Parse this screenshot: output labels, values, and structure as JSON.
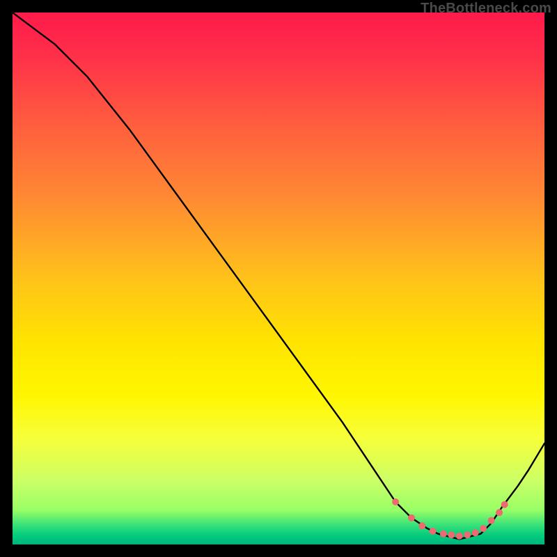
{
  "watermark": "TheBottleneck.com",
  "chart_data": {
    "type": "line",
    "title": "",
    "xlabel": "",
    "ylabel": "",
    "xlim": [
      0,
      100
    ],
    "ylim": [
      0,
      100
    ],
    "grid": false,
    "legend": false,
    "gradient_stops": [
      {
        "t": 0.0,
        "color": "#ff1a4b"
      },
      {
        "t": 0.08,
        "color": "#ff2f49"
      },
      {
        "t": 0.2,
        "color": "#ff5a3f"
      },
      {
        "t": 0.35,
        "color": "#ff8a33"
      },
      {
        "t": 0.5,
        "color": "#ffc21a"
      },
      {
        "t": 0.62,
        "color": "#ffe400"
      },
      {
        "t": 0.72,
        "color": "#fff600"
      },
      {
        "t": 0.8,
        "color": "#f7ff3a"
      },
      {
        "t": 0.88,
        "color": "#ccff66"
      },
      {
        "t": 0.935,
        "color": "#99ff66"
      },
      {
        "t": 0.965,
        "color": "#33e07a"
      },
      {
        "t": 0.985,
        "color": "#00c97e"
      },
      {
        "t": 1.0,
        "color": "#00b37d"
      }
    ],
    "series": [
      {
        "name": "bottleneck-curve",
        "x": [
          0,
          8,
          14,
          22,
          30,
          38,
          46,
          54,
          62,
          68,
          72,
          75,
          78,
          80,
          82,
          84,
          86,
          88,
          90,
          92,
          95,
          97,
          100
        ],
        "y": [
          100,
          94,
          88,
          78,
          67,
          56,
          45,
          34,
          23,
          14,
          8,
          5,
          3,
          2,
          1.5,
          1,
          1.5,
          2,
          4,
          7,
          11,
          14,
          19
        ]
      }
    ],
    "markers": {
      "name": "highlight-points",
      "color": "#ec6a70",
      "x": [
        72,
        75,
        77,
        79,
        81,
        82.5,
        84,
        85.5,
        87,
        88.5,
        90,
        91.5,
        92.5
      ],
      "y": [
        8,
        5,
        3.5,
        2.5,
        2,
        1.8,
        1.6,
        1.8,
        2.2,
        3,
        4.5,
        6,
        7.5
      ]
    }
  }
}
